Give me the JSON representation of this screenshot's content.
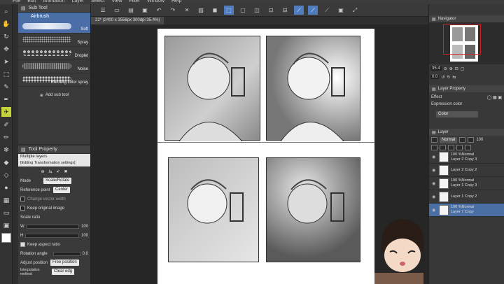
{
  "menu": [
    "File",
    "Edit",
    "Animation",
    "Layer",
    "Select",
    "View",
    "Filter",
    "Window",
    "Help"
  ],
  "subtool": {
    "header": "Sub Tool",
    "group_tab": "Airbrush",
    "brushes": [
      {
        "label": "Soft",
        "selected": true
      },
      {
        "label": "Spray",
        "selected": false
      },
      {
        "label": "Droplet",
        "selected": false
      },
      {
        "label": "Noise",
        "selected": false
      },
      {
        "label": "Running color spray",
        "selected": false
      }
    ],
    "add_label": "Add sub tool"
  },
  "toolprop": {
    "header": "Tool Property",
    "layers_tab": "Multiple layers",
    "editing_label": "[Editing Transformation settings]",
    "mode_label": "Mode",
    "mode_value": "Scale/Rotate",
    "ref_label": "Reference point",
    "ref_value": "Center",
    "vector_label": "Change vector width",
    "keep_orig_label": "Keep original image",
    "scale_label": "Scale ratio",
    "w_label": "W",
    "w_value": "100",
    "h_label": "H",
    "h_value": "100",
    "keep_aspect_label": "Keep aspect ratio",
    "rot_label": "Rotation angle",
    "rot_value": "0.0",
    "adjust_label": "Adjust position",
    "adjust_value": "Free position",
    "interp_label": "Interpolation method",
    "interp_value": "Clear edg"
  },
  "document": {
    "tab": "22* (2400 x 3556px 300dpi 35.4%)"
  },
  "navigator": {
    "header": "Navigator",
    "zoom": "35.4",
    "rotation": "0.0"
  },
  "layerprop": {
    "header": "Layer Property",
    "effect_label": "Effect",
    "expr_label": "Expression color",
    "expr_value": "Color"
  },
  "layer_panel": {
    "header": "Layer",
    "blend": "Normal",
    "opacity": "100",
    "layers": [
      {
        "top": "100 %Normal",
        "name": "Layer 2 Copy 3",
        "selected": false
      },
      {
        "top": "",
        "name": "Layer 2 Copy 2",
        "selected": false
      },
      {
        "top": "100 %Normal",
        "name": "Layer 1 Copy 3",
        "selected": false
      },
      {
        "top": "",
        "name": "Layer 1 Copy 2",
        "selected": false
      },
      {
        "top": "100 %Normal",
        "name": "Layer 7 Copy",
        "selected": true
      }
    ]
  },
  "colors": {
    "accent": "#4a6fa5",
    "tool_active": "#c4d33a",
    "navigator_frame": "#d22222"
  }
}
